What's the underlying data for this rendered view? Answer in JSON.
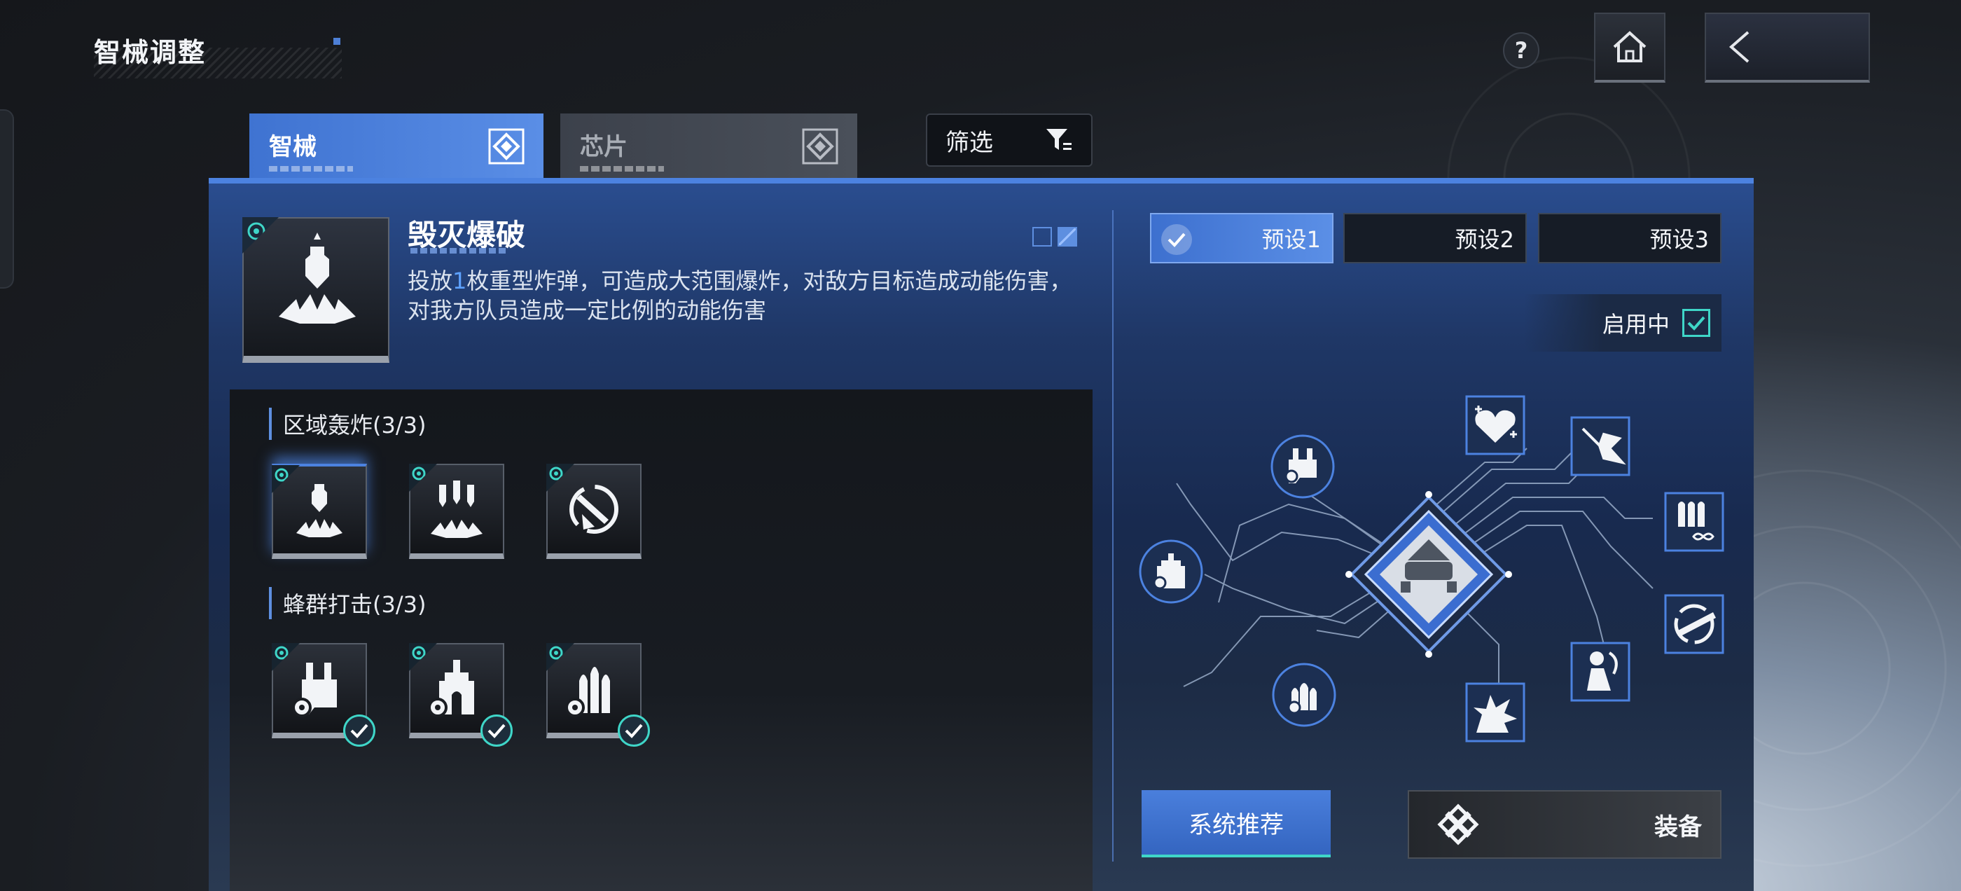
{
  "header": {
    "title": "智械调整"
  },
  "tabs": [
    {
      "label": "智械",
      "active": true
    },
    {
      "label": "芯片",
      "active": false
    }
  ],
  "filter": {
    "label": "筛选"
  },
  "selected_skill": {
    "name": "毁灭爆破",
    "desc_prefix": "投放",
    "desc_highlight": "1",
    "desc_suffix": "枚重型炸弹，可造成大范围爆炸，对敌方目标造成动能伤害，对我方队员造成一定比例的动能伤害"
  },
  "groups": [
    {
      "title": "区域轰炸(3/3)",
      "slots": [
        "bomb-icon",
        "triple-bomb-icon",
        "orbit-strike-icon"
      ]
    },
    {
      "title": "蜂群打击(3/3)",
      "slots": [
        "drone-gear-icon",
        "turret-gear-icon",
        "swarm-gear-icon"
      ]
    }
  ],
  "presets": [
    {
      "label": "预设1",
      "active": true
    },
    {
      "label": "预设2",
      "active": false
    },
    {
      "label": "预设3",
      "active": false
    }
  ],
  "status": {
    "enabled_label": "启用中",
    "enabled": true
  },
  "buttons": {
    "recommend": "系统推荐",
    "equip": "装备"
  },
  "colors": {
    "accent_blue": "#4c82e0",
    "check_teal": "#3fd6c8"
  }
}
